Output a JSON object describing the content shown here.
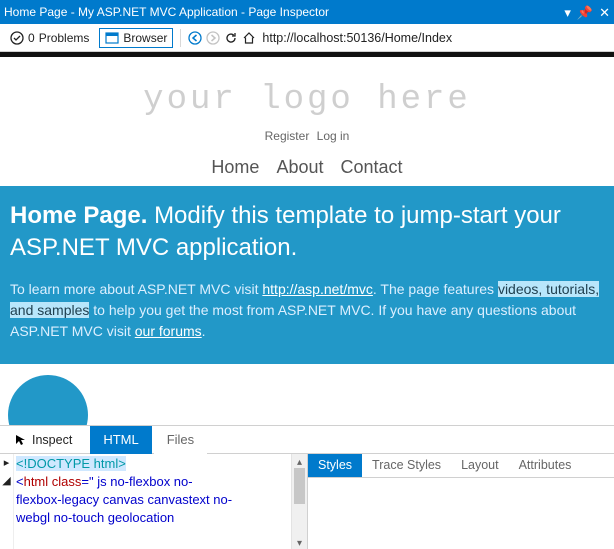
{
  "window": {
    "title": "Home Page - My ASP.NET MVC Application - Page Inspector"
  },
  "toolbar": {
    "problems_count": "0",
    "problems_label": "Problems",
    "browser_label": "Browser",
    "url": "http://localhost:50136/Home/Index"
  },
  "page": {
    "logo": "your logo here",
    "auth": {
      "register": "Register",
      "login": "Log in"
    },
    "nav": {
      "home": "Home",
      "about": "About",
      "contact": "Contact"
    },
    "hero": {
      "title_bold": "Home Page.",
      "title_rest": "Modify this template to jump-start your ASP.NET MVC application.",
      "lead_pre": "To learn more about ASP.NET MVC visit ",
      "link1": "http://asp.net/mvc",
      "lead_mid1": ". The page features ",
      "hilite": "videos, tutorials, and samples",
      "lead_mid2": " to help you get the most from ASP.NET MVC. If you have any questions about ASP.NET MVC visit ",
      "link2": "our forums",
      "lead_end": "."
    }
  },
  "inspector": {
    "inspect_label": "Inspect",
    "tab_html": "HTML",
    "tab_files": "Files",
    "code": {
      "line1": "<!DOCTYPE html>",
      "line2a": "<",
      "line2b": "html",
      "line2c": " class",
      "line2d": "=\" js no-flexbox no-",
      "line3": "flexbox-legacy canvas canvastext no-",
      "line4": "webgl no-touch geolocation"
    },
    "style_tabs": {
      "styles": "Styles",
      "trace": "Trace Styles",
      "layout": "Layout",
      "attrs": "Attributes"
    }
  }
}
